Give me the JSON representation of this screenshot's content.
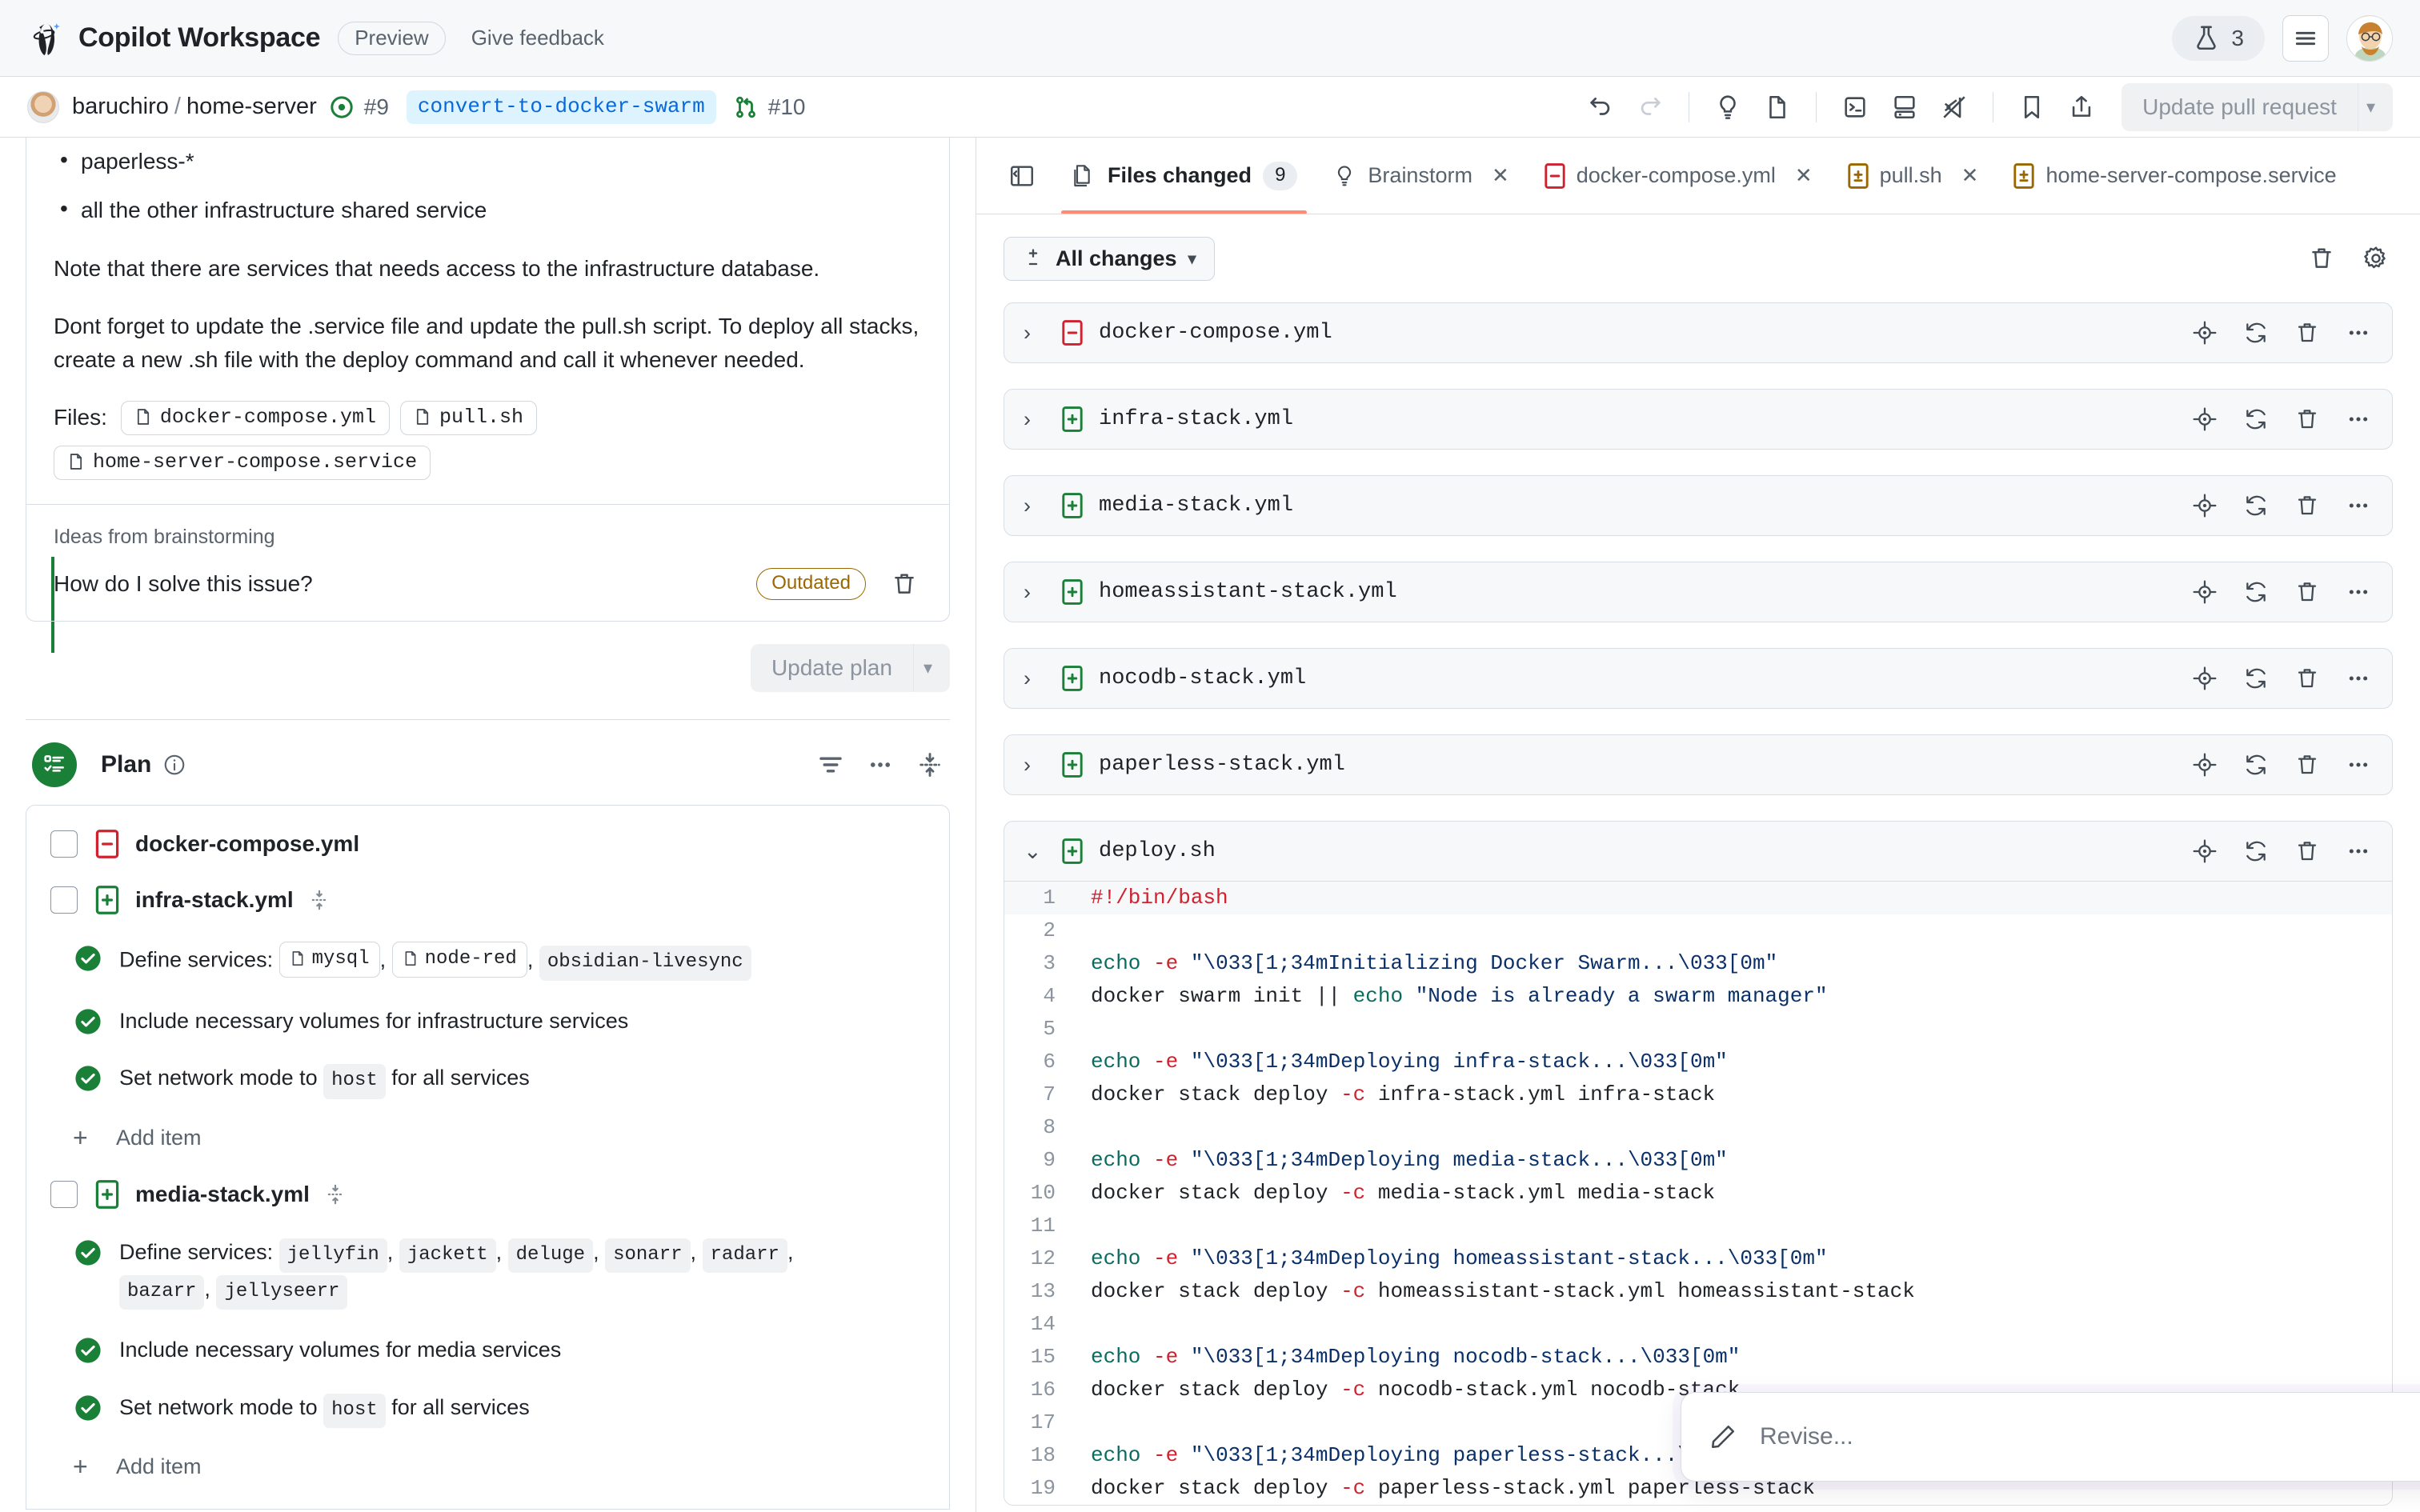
{
  "header": {
    "app_title": "Copilot Workspace",
    "preview_label": "Preview",
    "feedback_label": "Give feedback",
    "lab_count": "3",
    "logo_icon": "copilot-logo-icon",
    "menu_icon": "hamburger-menu-icon",
    "avatar_icon": "user-avatar"
  },
  "repo_bar": {
    "owner": "baruchiro",
    "separator": "/",
    "repo": "home-server",
    "issue_number": "#9",
    "branch": "convert-to-docker-swarm",
    "pr_number": "#10",
    "update_pr_label": "Update pull request",
    "icons": [
      "undo-icon",
      "redo-icon",
      "lightbulb-icon",
      "folder-icon",
      "terminal-icon",
      "codespace-icon",
      "vscode-icon",
      "bookmark-icon",
      "share-icon"
    ]
  },
  "left": {
    "spec": {
      "bullets": [
        "paperless-*",
        "all the other infrastructure shared service"
      ],
      "paragraphs": [
        "Note that there are services that needs access to the infrastructure database.",
        "Dont forget to update the .service file and update the pull.sh script. To deploy all stacks, create a new .sh file with the deploy command and call it whenever needed."
      ],
      "files_label": "Files:",
      "file_chips": [
        "docker-compose.yml",
        "pull.sh",
        "home-server-compose.service"
      ]
    },
    "ideas": {
      "title": "Ideas from brainstorming",
      "question": "How do I solve this issue?",
      "status_badge": "Outdated",
      "delete_icon": "trash-icon"
    },
    "update_plan_label": "Update plan",
    "plan": {
      "title": "Plan",
      "info_icon": "info-icon",
      "actions": [
        "filter-icon",
        "more-options-icon",
        "collapse-expand-icon"
      ],
      "add_item_label": "Add item",
      "files": [
        {
          "name": "docker-compose.yml",
          "status": "deleted",
          "items": []
        },
        {
          "name": "infra-stack.yml",
          "status": "added",
          "items": [
            {
              "prefix": "Define services: ",
              "chips": [
                {
                  "text": "mysql",
                  "file": true
                },
                {
                  "text": "node-red",
                  "file": true
                },
                {
                  "text": "obsidian-livesync",
                  "file": false
                }
              ],
              "suffix": ""
            },
            {
              "prefix": "Include necessary volumes for infrastructure services",
              "chips": [],
              "suffix": ""
            },
            {
              "prefix": "Set network mode to ",
              "chips": [
                {
                  "text": "host",
                  "file": false
                }
              ],
              "suffix": " for all services"
            }
          ]
        },
        {
          "name": "media-stack.yml",
          "status": "added",
          "items": [
            {
              "prefix": "Define services: ",
              "chips": [
                {
                  "text": "jellyfin",
                  "file": false
                },
                {
                  "text": "jackett",
                  "file": false
                },
                {
                  "text": "deluge",
                  "file": false
                },
                {
                  "text": "sonarr",
                  "file": false
                },
                {
                  "text": "radarr",
                  "file": false
                },
                {
                  "text": "bazarr",
                  "file": false
                },
                {
                  "text": "jellyseerr",
                  "file": false
                }
              ],
              "suffix": ""
            },
            {
              "prefix": "Include necessary volumes for media services",
              "chips": [],
              "suffix": ""
            },
            {
              "prefix": "Set network mode to ",
              "chips": [
                {
                  "text": "host",
                  "file": false
                }
              ],
              "suffix": " for all services"
            }
          ]
        }
      ]
    }
  },
  "right": {
    "panel_toggle_icon": "collapse-panel-icon",
    "tabs": [
      {
        "label": "Files changed",
        "icon": "files-icon",
        "count": "9",
        "active": true,
        "closable": false
      },
      {
        "label": "Brainstorm",
        "icon": "lightbulb-icon",
        "count": null,
        "active": false,
        "closable": true
      },
      {
        "label": "docker-compose.yml",
        "icon": "file-deleted-icon",
        "count": null,
        "active": false,
        "closable": true
      },
      {
        "label": "pull.sh",
        "icon": "file-modified-icon",
        "count": null,
        "active": false,
        "closable": true
      },
      {
        "label": "home-server-compose.service",
        "icon": "file-modified-icon",
        "count": null,
        "active": false,
        "closable": true
      }
    ],
    "toolbar": {
      "all_changes_label": "All changes",
      "dropdown_icon": "chevron-down-icon",
      "trash_icon": "trash-icon",
      "settings_icon": "gear-icon"
    },
    "row_actions": [
      "target-icon",
      "regenerate-icon",
      "trash-icon",
      "more-options-icon"
    ],
    "files": [
      {
        "name": "docker-compose.yml",
        "status": "deleted",
        "expanded": false
      },
      {
        "name": "infra-stack.yml",
        "status": "added",
        "expanded": false
      },
      {
        "name": "media-stack.yml",
        "status": "added",
        "expanded": false
      },
      {
        "name": "homeassistant-stack.yml",
        "status": "added",
        "expanded": false
      },
      {
        "name": "nocodb-stack.yml",
        "status": "added",
        "expanded": false
      },
      {
        "name": "paperless-stack.yml",
        "status": "added",
        "expanded": false
      },
      {
        "name": "deploy.sh",
        "status": "added",
        "expanded": true
      }
    ],
    "diff": {
      "file": "deploy.sh",
      "lines": [
        {
          "n": "1",
          "hl": true,
          "tokens": [
            {
              "t": "#!/bin/bash",
              "c": "k-red"
            }
          ]
        },
        {
          "n": "2",
          "hl": false,
          "tokens": []
        },
        {
          "n": "3",
          "hl": false,
          "tokens": [
            {
              "t": "echo",
              "c": "k-teal"
            },
            {
              "t": " ",
              "c": ""
            },
            {
              "t": "-e",
              "c": "k-red"
            },
            {
              "t": " ",
              "c": ""
            },
            {
              "t": "\"\\033[1;34mInitializing Docker Swarm...\\033[0m\"",
              "c": "k-str"
            }
          ]
        },
        {
          "n": "4",
          "hl": false,
          "tokens": [
            {
              "t": "docker swarm init || ",
              "c": ""
            },
            {
              "t": "echo",
              "c": "k-teal"
            },
            {
              "t": " ",
              "c": ""
            },
            {
              "t": "\"Node is already a swarm manager\"",
              "c": "k-str"
            }
          ]
        },
        {
          "n": "5",
          "hl": false,
          "tokens": []
        },
        {
          "n": "6",
          "hl": false,
          "tokens": [
            {
              "t": "echo",
              "c": "k-teal"
            },
            {
              "t": " ",
              "c": ""
            },
            {
              "t": "-e",
              "c": "k-red"
            },
            {
              "t": " ",
              "c": ""
            },
            {
              "t": "\"\\033[1;34mDeploying infra-stack...\\033[0m\"",
              "c": "k-str"
            }
          ]
        },
        {
          "n": "7",
          "hl": false,
          "tokens": [
            {
              "t": "docker stack deploy ",
              "c": ""
            },
            {
              "t": "-c",
              "c": "k-red"
            },
            {
              "t": " infra-stack.yml infra-stack",
              "c": ""
            }
          ]
        },
        {
          "n": "8",
          "hl": false,
          "tokens": []
        },
        {
          "n": "9",
          "hl": false,
          "tokens": [
            {
              "t": "echo",
              "c": "k-teal"
            },
            {
              "t": " ",
              "c": ""
            },
            {
              "t": "-e",
              "c": "k-red"
            },
            {
              "t": " ",
              "c": ""
            },
            {
              "t": "\"\\033[1;34mDeploying media-stack...\\033[0m\"",
              "c": "k-str"
            }
          ]
        },
        {
          "n": "10",
          "hl": false,
          "tokens": [
            {
              "t": "docker stack deploy ",
              "c": ""
            },
            {
              "t": "-c",
              "c": "k-red"
            },
            {
              "t": " media-stack.yml media-stack",
              "c": ""
            }
          ]
        },
        {
          "n": "11",
          "hl": false,
          "tokens": []
        },
        {
          "n": "12",
          "hl": false,
          "tokens": [
            {
              "t": "echo",
              "c": "k-teal"
            },
            {
              "t": " ",
              "c": ""
            },
            {
              "t": "-e",
              "c": "k-red"
            },
            {
              "t": " ",
              "c": ""
            },
            {
              "t": "\"\\033[1;34mDeploying homeassistant-stack...\\033[0m\"",
              "c": "k-str"
            }
          ]
        },
        {
          "n": "13",
          "hl": false,
          "tokens": [
            {
              "t": "docker stack deploy ",
              "c": ""
            },
            {
              "t": "-c",
              "c": "k-red"
            },
            {
              "t": " homeassistant-stack.yml homeassistant-stack",
              "c": ""
            }
          ]
        },
        {
          "n": "14",
          "hl": false,
          "tokens": []
        },
        {
          "n": "15",
          "hl": false,
          "tokens": [
            {
              "t": "echo",
              "c": "k-teal"
            },
            {
              "t": " ",
              "c": ""
            },
            {
              "t": "-e",
              "c": "k-red"
            },
            {
              "t": " ",
              "c": ""
            },
            {
              "t": "\"\\033[1;34mDeploying nocodb-stack...\\033[0m\"",
              "c": "k-str"
            }
          ]
        },
        {
          "n": "16",
          "hl": false,
          "tokens": [
            {
              "t": "docker stack deploy ",
              "c": ""
            },
            {
              "t": "-c",
              "c": "k-red"
            },
            {
              "t": " nocodb-stack.yml nocodb-stack",
              "c": ""
            }
          ]
        },
        {
          "n": "17",
          "hl": false,
          "tokens": []
        },
        {
          "n": "18",
          "hl": false,
          "tokens": [
            {
              "t": "echo",
              "c": "k-teal"
            },
            {
              "t": " ",
              "c": ""
            },
            {
              "t": "-e",
              "c": "k-red"
            },
            {
              "t": " ",
              "c": ""
            },
            {
              "t": "\"\\033[1;34mDeploying paperless-stack...\\033[0m\"",
              "c": "k-str"
            }
          ]
        },
        {
          "n": "19",
          "hl": false,
          "tokens": [
            {
              "t": "docker stack deploy ",
              "c": ""
            },
            {
              "t": "-c",
              "c": "k-red"
            },
            {
              "t": " paperless-stack.yml paperless-stack",
              "c": ""
            }
          ]
        }
      ]
    }
  },
  "revise": {
    "placeholder": "Revise...",
    "pencil_icon": "pencil-icon",
    "send_icon": "send-icon"
  },
  "colors": {
    "accent_orange": "#fd8c73",
    "green": "#1a7f37",
    "red": "#cf222e",
    "blue": "#0969da",
    "branch_bg": "#ddf4ff",
    "outdated": "#9a6700"
  }
}
